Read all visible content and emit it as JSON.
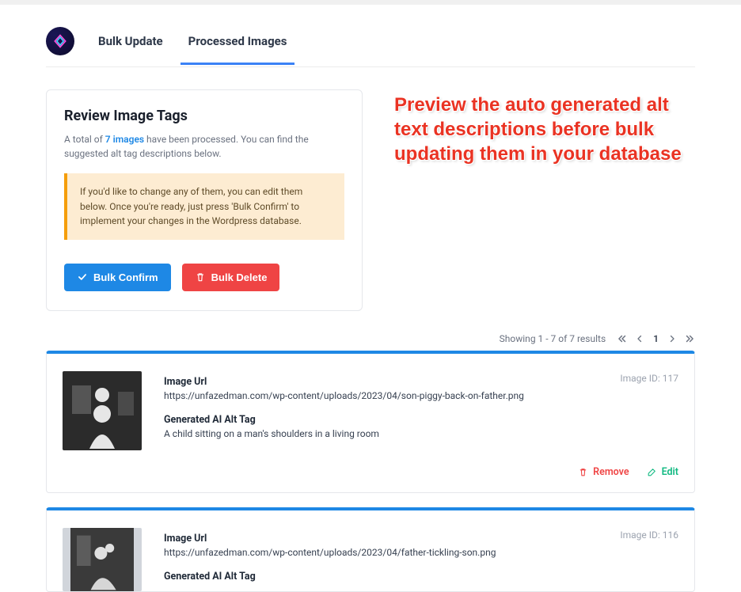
{
  "tabs": [
    {
      "label": "Bulk Update",
      "active": false
    },
    {
      "label": "Processed Images",
      "active": true
    }
  ],
  "review": {
    "heading": "Review Image Tags",
    "summary_prefix": "A total of ",
    "summary_count": "7 images",
    "summary_suffix": " have been processed. You can find the suggested alt tag descriptions below.",
    "alert": "If you'd like to change any of them, you can edit them below. Once you're ready, just press 'Bulk Confirm' to implement your changes in the Wordpress database.",
    "confirm_label": "Bulk Confirm",
    "delete_label": "Bulk Delete"
  },
  "hero": "Preview the auto generated alt text descriptions before bulk updating them in your database",
  "pager": {
    "summary": "Showing 1 - 7 of 7 results",
    "page": "1"
  },
  "labels": {
    "image_id_prefix": "Image ID: ",
    "image_url": "Image Url",
    "alt_tag": "Generated AI Alt Tag",
    "remove": "Remove",
    "edit": "Edit"
  },
  "results": [
    {
      "id": "117",
      "url": "https://unfazedman.com/wp-content/uploads/2023/04/son-piggy-back-on-father.png",
      "alt": "A child sitting on a man's shoulders in a living room"
    },
    {
      "id": "116",
      "url": "https://unfazedman.com/wp-content/uploads/2023/04/father-tickling-son.png",
      "alt": ""
    }
  ]
}
